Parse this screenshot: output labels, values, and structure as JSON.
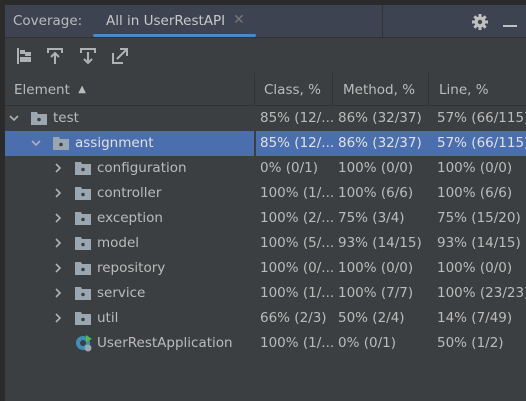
{
  "panel": {
    "label": "Coverage:",
    "tab": "All in UserRestAPI"
  },
  "toolbar": [
    "flatten-packages-icon",
    "import-icon",
    "export-icon",
    "navigate-icon"
  ],
  "columns": [
    "Element",
    "Class, %",
    "Method, %",
    "Line, %"
  ],
  "rows": [
    {
      "name": "test",
      "indent": 0,
      "expanded": true,
      "type": "folder",
      "class": "85% (12/...",
      "method": "86% (32/37)",
      "line": "57% (66/115)"
    },
    {
      "name": "assignment",
      "indent": 1,
      "expanded": true,
      "type": "folder",
      "selected": true,
      "class": "85% (12/...",
      "method": "86% (32/37)",
      "line": "57% (66/115)"
    },
    {
      "name": "configuration",
      "indent": 2,
      "type": "folder",
      "class": "0% (0/1)",
      "method": "100% (0/0)",
      "line": "100% (0/0)"
    },
    {
      "name": "controller",
      "indent": 2,
      "type": "folder",
      "class": "100% (1/...",
      "method": "100% (6/6)",
      "line": "100% (6/6)"
    },
    {
      "name": "exception",
      "indent": 2,
      "type": "folder",
      "class": "100% (2/...",
      "method": "75% (3/4)",
      "line": "75% (15/20)"
    },
    {
      "name": "model",
      "indent": 2,
      "type": "folder",
      "class": "100% (5/...",
      "method": "93% (14/15)",
      "line": "93% (14/15)"
    },
    {
      "name": "repository",
      "indent": 2,
      "type": "folder",
      "class": "100% (0/...",
      "method": "100% (0/0)",
      "line": "100% (0/0)"
    },
    {
      "name": "service",
      "indent": 2,
      "type": "folder",
      "class": "100% (1/...",
      "method": "100% (7/7)",
      "line": "100% (23/23)"
    },
    {
      "name": "util",
      "indent": 2,
      "type": "folder",
      "class": "66% (2/3)",
      "method": "50% (2/4)",
      "line": "14% (7/49)"
    },
    {
      "name": "UserRestApplication",
      "indent": 2,
      "type": "spring-class",
      "class": "100% (1/...",
      "method": "0% (0/1)",
      "line": "50% (1/2)"
    }
  ],
  "colors": {
    "selection": "#4b6eaf",
    "accent": "#4a88c7"
  }
}
